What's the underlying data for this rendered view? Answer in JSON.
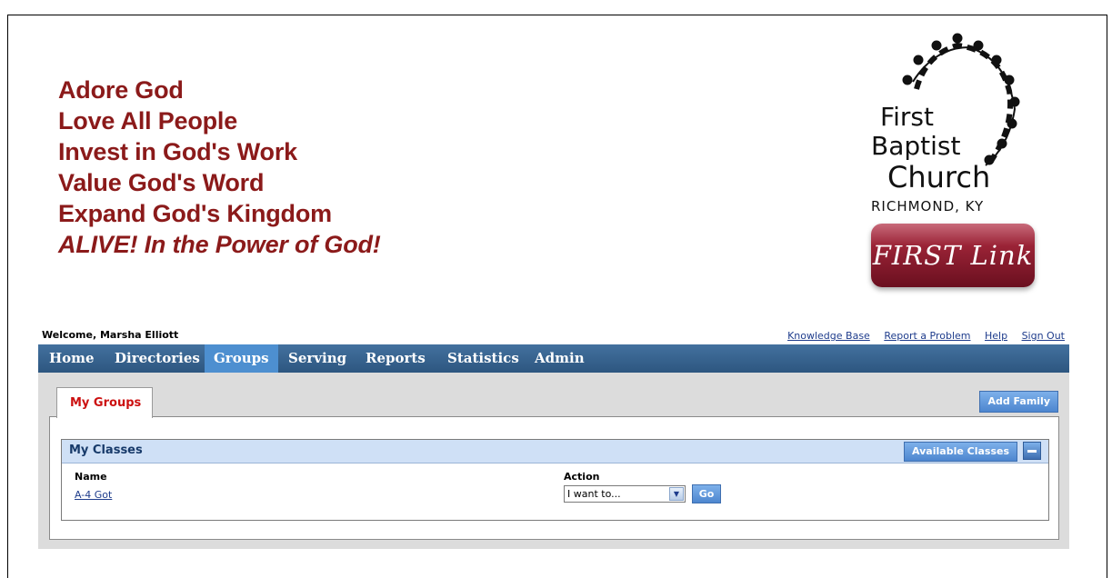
{
  "header": {
    "mottos": [
      "Adore God",
      "Love All People",
      "Invest in God's Work",
      "Value God's Word",
      "Expand God's Kingdom",
      "ALIVE!  In the Power of God!"
    ],
    "logo": {
      "line1": "First",
      "line2": "Baptist",
      "line3": "Church",
      "city": "RICHMOND, KY",
      "button": "FIRST Link"
    }
  },
  "user": {
    "welcome": "Welcome, Marsha Elliott"
  },
  "top_links": [
    "Knowledge Base",
    "Report a Problem",
    "Help",
    "Sign Out"
  ],
  "nav": {
    "items": [
      "Home",
      "Directories",
      "Groups",
      "Serving",
      "Reports",
      "Statistics",
      "Admin"
    ],
    "active": "Groups"
  },
  "tabs": {
    "my_groups": "My Groups"
  },
  "buttons": {
    "add_family": "Add Family",
    "available_classes": "Available Classes",
    "go": "Go"
  },
  "classes": {
    "title": "My Classes",
    "columns": {
      "name": "Name",
      "action": "Action"
    },
    "rows": [
      {
        "name": "A-4 Got",
        "action_selected": "I want to..."
      }
    ]
  },
  "colors": {
    "nav_bg": "#2d5680",
    "nav_active": "#4d8fd0",
    "motto": "#8b1a1a",
    "tab_text": "#cc1111"
  }
}
